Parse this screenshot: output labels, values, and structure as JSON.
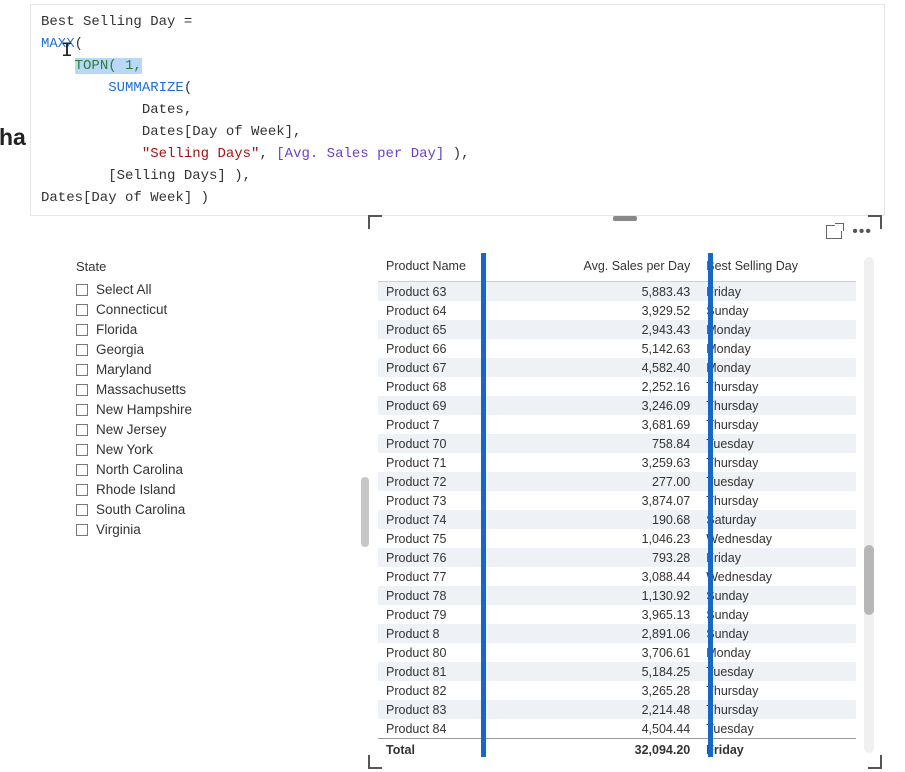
{
  "formula": {
    "line1_pre": "Best Selling Day =",
    "maxx": "MAXX",
    "topn": "TOPN( 1,",
    "summarize": "SUMMARIZE",
    "dates_tbl": "Dates,",
    "dates_col": "Dates[Day of Week],",
    "str_literal": "\"Selling Days\"",
    "measure": "[Avg. Sales per Day]",
    "close1": " ),",
    "selling_days_ref": "[Selling Days] ),",
    "last_line": "Dates[Day of Week] )"
  },
  "cut_label": "ha",
  "slicer": {
    "title": "State",
    "items": [
      "Select All",
      "Connecticut",
      "Florida",
      "Georgia",
      "Maryland",
      "Massachusetts",
      "New Hampshire",
      "New Jersey",
      "New York",
      "North Carolina",
      "Rhode Island",
      "South Carolina",
      "Virginia"
    ]
  },
  "table": {
    "columns": [
      "Product Name",
      "Avg. Sales per Day",
      "Best Selling Day"
    ],
    "rows": [
      {
        "p": "Product 63",
        "v": "5,883.43",
        "d": "Friday"
      },
      {
        "p": "Product 64",
        "v": "3,929.52",
        "d": "Sunday"
      },
      {
        "p": "Product 65",
        "v": "2,943.43",
        "d": "Monday"
      },
      {
        "p": "Product 66",
        "v": "5,142.63",
        "d": "Monday"
      },
      {
        "p": "Product 67",
        "v": "4,582.40",
        "d": "Monday"
      },
      {
        "p": "Product 68",
        "v": "2,252.16",
        "d": "Thursday"
      },
      {
        "p": "Product 69",
        "v": "3,246.09",
        "d": "Thursday"
      },
      {
        "p": "Product 7",
        "v": "3,681.69",
        "d": "Thursday"
      },
      {
        "p": "Product 70",
        "v": "758.84",
        "d": "Tuesday"
      },
      {
        "p": "Product 71",
        "v": "3,259.63",
        "d": "Thursday"
      },
      {
        "p": "Product 72",
        "v": "277.00",
        "d": "Tuesday"
      },
      {
        "p": "Product 73",
        "v": "3,874.07",
        "d": "Thursday"
      },
      {
        "p": "Product 74",
        "v": "190.68",
        "d": "Saturday"
      },
      {
        "p": "Product 75",
        "v": "1,046.23",
        "d": "Wednesday"
      },
      {
        "p": "Product 76",
        "v": "793.28",
        "d": "Friday"
      },
      {
        "p": "Product 77",
        "v": "3,088.44",
        "d": "Wednesday"
      },
      {
        "p": "Product 78",
        "v": "1,130.92",
        "d": "Sunday"
      },
      {
        "p": "Product 79",
        "v": "3,965.13",
        "d": "Sunday"
      },
      {
        "p": "Product 8",
        "v": "2,891.06",
        "d": "Sunday"
      },
      {
        "p": "Product 80",
        "v": "3,706.61",
        "d": "Monday"
      },
      {
        "p": "Product 81",
        "v": "5,184.25",
        "d": "Tuesday"
      },
      {
        "p": "Product 82",
        "v": "3,265.28",
        "d": "Thursday"
      },
      {
        "p": "Product 83",
        "v": "2,214.48",
        "d": "Thursday"
      },
      {
        "p": "Product 84",
        "v": "4,504.44",
        "d": "Tuesday"
      }
    ],
    "total": {
      "label": "Total",
      "v": "32,094.20",
      "d": "Friday"
    }
  }
}
